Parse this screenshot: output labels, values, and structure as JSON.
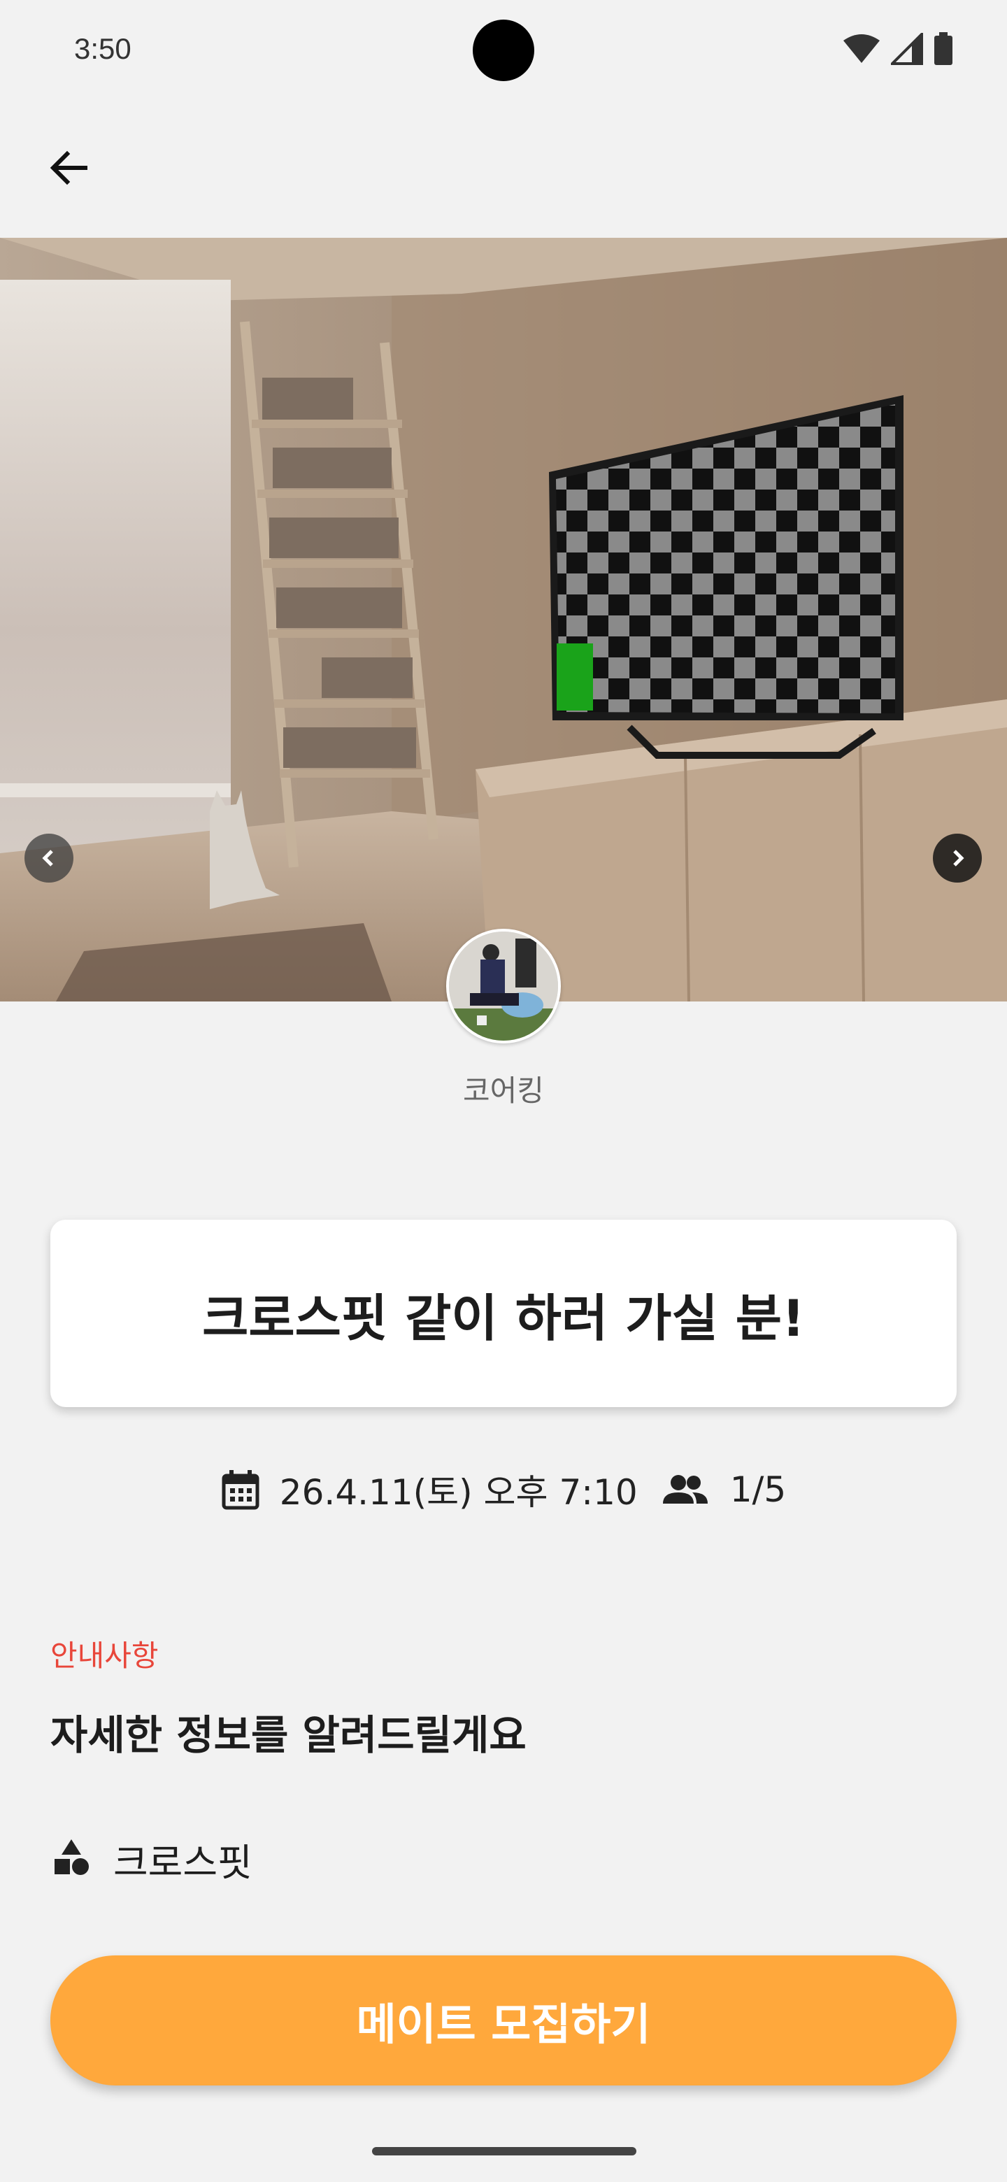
{
  "status_bar": {
    "time": "3:50",
    "icons": [
      "wifi-icon",
      "cellular-signal-icon",
      "battery-icon"
    ]
  },
  "app_bar": {
    "back_icon": "arrow-left-icon"
  },
  "hero": {
    "image": "room-with-tv-checkerboard-photo",
    "prev_icon": "chevron-left-icon",
    "next_icon": "chevron-right-icon"
  },
  "author": {
    "avatar": "workout-photo-avatar",
    "name": "코어킹"
  },
  "post": {
    "title": "크로스핏 같이 하러 가실 분!",
    "datetime": "26.4.11(토) 오후 7:10",
    "participants": "1/5"
  },
  "info": {
    "label": "안내사항",
    "heading": "자세한 정보를 알려드릴게요",
    "category": "크로스핏",
    "category_icon": "shapes-icon"
  },
  "cta": {
    "label": "메이트 모집하기"
  },
  "colors": {
    "background": "#f2f2f2",
    "accent": "#ffa83c",
    "info_label": "#e8463a",
    "title_text": "#1d1d1d"
  }
}
